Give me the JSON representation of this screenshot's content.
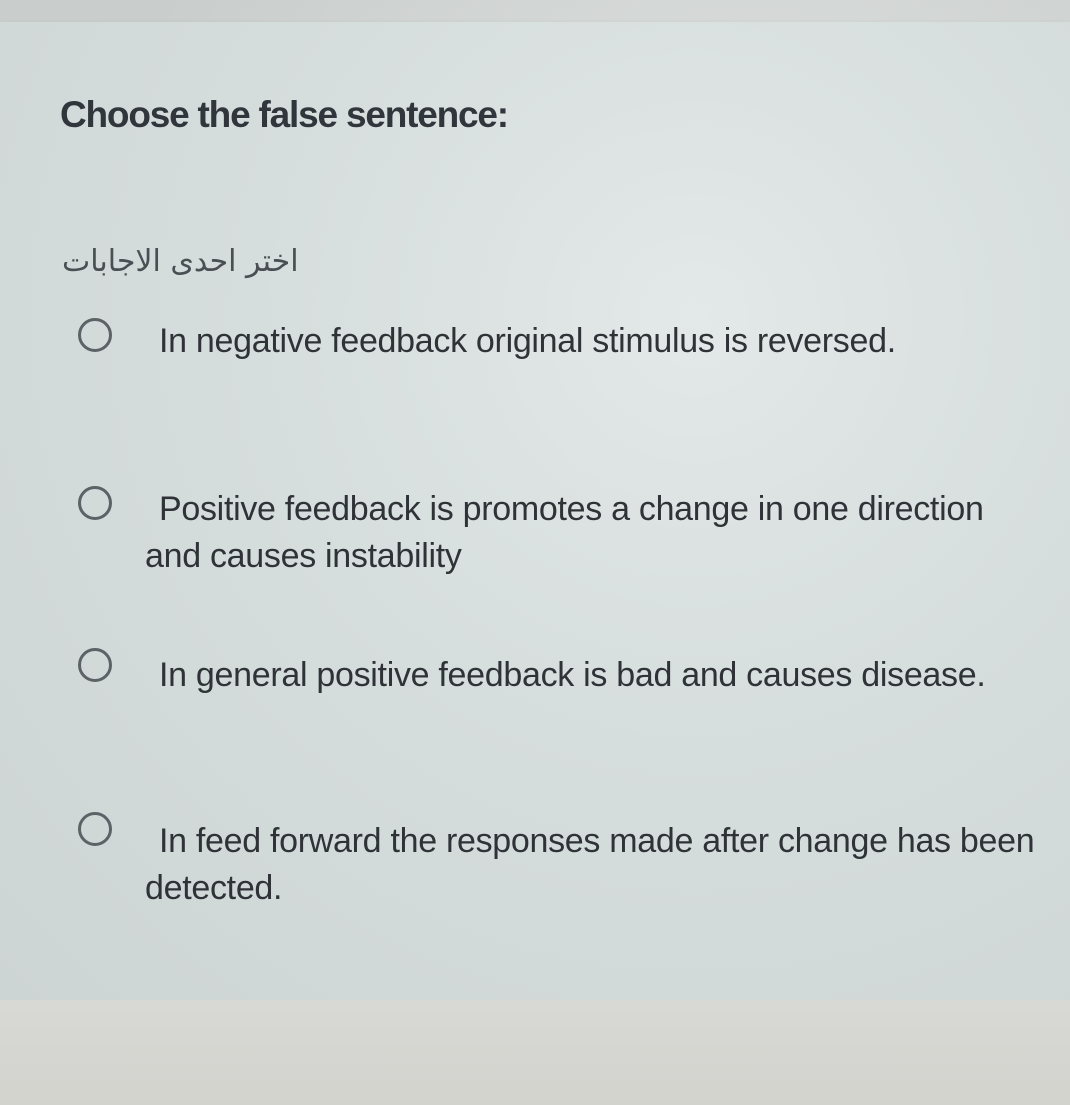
{
  "question": {
    "title": "Choose the false sentence:",
    "instruction": "اختر احدى الاجابات"
  },
  "options": [
    {
      "label": "In negative feedback original stimulus is reversed."
    },
    {
      "label": "Positive feedback is promotes a change in one direction and causes instability"
    },
    {
      "label": "In general positive feedback is bad and causes disease."
    },
    {
      "label": "In feed forward the responses made after change has been detected."
    }
  ],
  "colors": {
    "card_background": "#dde3e3",
    "text": "#2f3338",
    "radio_border": "#5d6267"
  }
}
